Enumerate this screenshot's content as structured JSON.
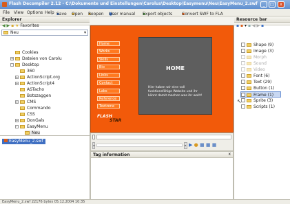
{
  "window": {
    "title": "Flash Decompiler 2.12 - C:\\Dokumente und Einstellungen\\Carolus\\Desktop\\Easymenu\\Neu\\EasyMenu_2.swf",
    "minimize": "_",
    "maximize": "□",
    "close": "x"
  },
  "menu": {
    "file": "File",
    "view": "View",
    "options": "Options",
    "help": "Help",
    "save": "Save",
    "open": "Open",
    "reopen": "Reopen",
    "user_manual": "User manual",
    "export_objects": "Export objects",
    "convert": "Convert SWF to FLA"
  },
  "explorer": {
    "title": "Explorer",
    "favorites": "Favorites",
    "path": "Neu",
    "tree": [
      {
        "label": "Cookies"
      },
      {
        "label": "Dateien von Carolu"
      },
      {
        "label": "Desktop"
      },
      {
        "label": "360"
      },
      {
        "label": "ActionScript.org"
      },
      {
        "label": "ActionScript4"
      },
      {
        "label": "ASTacho"
      },
      {
        "label": "Botszaggen"
      },
      {
        "label": "CMS"
      },
      {
        "label": "Commando"
      },
      {
        "label": "CSS"
      },
      {
        "label": "DonGals"
      },
      {
        "label": "EasyMenu"
      },
      {
        "label": "Neu"
      }
    ]
  },
  "files": {
    "selected": "EasyMenu_2.swf"
  },
  "stage": {
    "nav": [
      "Home",
      "Works",
      "Skills",
      "Bio",
      "Links",
      "Contact",
      "Labs",
      "Reference",
      "Textzone"
    ],
    "logo_line1": "FLASH",
    "logo_line2": "STAR",
    "home_title": "HOME",
    "home_text": "Hier haben wir eine voll funktionsfähige Website und ihr könnt damit machen was ihr wollt!"
  },
  "taginfo": {
    "title": "Tag information",
    "close": "x"
  },
  "resources": {
    "title": "Resource bar",
    "items": [
      {
        "label": "Shape (9)",
        "enabled": true
      },
      {
        "label": "Image (3)",
        "enabled": true
      },
      {
        "label": "Morph",
        "enabled": false
      },
      {
        "label": "Sound",
        "enabled": false
      },
      {
        "label": "Video",
        "enabled": false
      },
      {
        "label": "Font (6)",
        "enabled": true
      },
      {
        "label": "Text (29)",
        "enabled": true
      },
      {
        "label": "Button (1)",
        "enabled": true
      },
      {
        "label": "Frame (1)",
        "enabled": true,
        "selected": true
      },
      {
        "label": "Sprite (3)",
        "enabled": true
      },
      {
        "label": "Scripts (1)",
        "enabled": true
      }
    ]
  },
  "status": {
    "text": "EasyMenu_2.swf     22176 bytes  05.12.2004 10:35"
  },
  "colors": {
    "stage_bg": "#f25a0a",
    "home_box": "#5e5e5e",
    "titlebar": "#5f8fcf"
  }
}
